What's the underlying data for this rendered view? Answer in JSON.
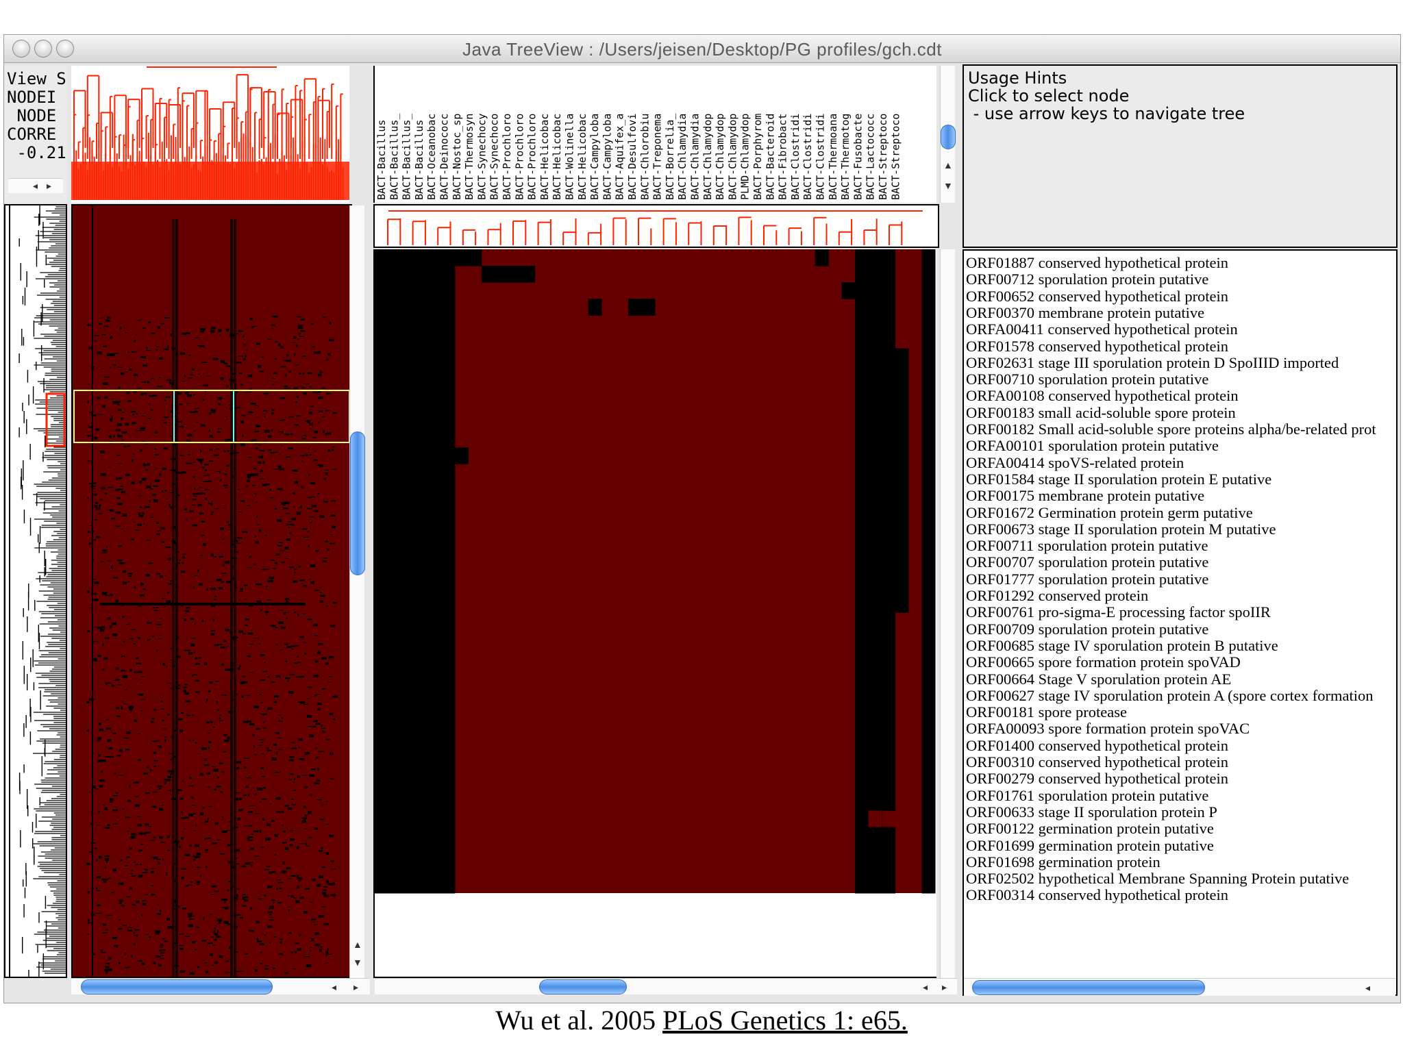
{
  "window": {
    "title": "Java TreeView :  /Users/jeisen/Desktop/PG profiles/gch.cdt"
  },
  "view_stats": {
    "lines": [
      "View St",
      "NODEI",
      " NODE",
      "CORRE",
      " -0.21"
    ]
  },
  "array_names": [
    "BACT-Bacillus",
    "BACT-Bacillus_",
    "BACT-Bacillus_",
    "BACT-Bacillus",
    "BACT-Oceanobac",
    "BACT-Deinococc",
    "BACT-Nostoc_sp",
    "BACT-Thermosyn",
    "BACT-Synechocy",
    "BACT-Synechoco",
    "BACT-Prochloro",
    "BACT-Prochloro",
    "BACT-Prochloro",
    "BACT-Helicobac",
    "BACT-Helicobac",
    "BACT-Wolinella",
    "BACT-Helicobac",
    "BACT-Campyloba",
    "BACT-Campyloba",
    "BACT-Aquifex_a",
    "BACT-Desulfovi",
    "BACT-Chlorobiu",
    "BACT-Treponema",
    "BACT-Borrelia_",
    "BACT-Chlamydia",
    "BACT-Chlamydia",
    "BACT-Chlamydop",
    "BACT-Chlamydop",
    "BACT-Chlamydop",
    "PLMD-Chlamydop",
    "BACT-Porphyrom",
    "BACT-Bacteroid",
    "BACT-Fibrobact",
    "BACT-Clostridi",
    "BACT-Clostridi",
    "BACT-Clostridi",
    "BACT-Thermoana",
    "BACT-Thermotog",
    "BACT-Fusobacte",
    "BACT-Lactococc",
    "BACT-Streptoco",
    "BACT-Streptoco"
  ],
  "usage_hints": {
    "title": "Usage Hints",
    "line1": "Click to select node",
    "line2": " - use arrow keys to navigate tree"
  },
  "genes": [
    "ORF01887 conserved hypothetical protein",
    "ORF00712 sporulation protein putative",
    "ORF00652 conserved hypothetical protein",
    "ORF00370 membrane protein putative",
    "ORFA00411 conserved hypothetical protein",
    "ORF01578 conserved hypothetical protein",
    "ORF02631 stage III sporulation protein D SpoIIID imported",
    "ORF00710 sporulation protein putative",
    "ORFA00108 conserved hypothetical protein",
    "ORF00183 small acid-soluble spore protein",
    "ORF00182 Small acid-soluble spore proteins alpha/be-related prot",
    "ORFA00101 sporulation protein putative",
    "ORFA00414 spoVS-related protein",
    "ORF01584 stage II sporulation protein E putative",
    "ORF00175 membrane protein putative",
    "ORF01672 Germination protein germ putative",
    "ORF00673 stage II sporulation protein M putative",
    "ORF00711 sporulation protein putative",
    "ORF00707 sporulation protein putative",
    "ORF01777 sporulation protein putative",
    "ORF01292 conserved protein",
    "ORF00761 pro-sigma-E processing factor spoIIR",
    "ORF00709 sporulation protein putative",
    "ORF00685 stage IV sporulation protein B putative",
    "ORF00665 spore formation protein spoVAD",
    "ORF00664 Stage V sporulation protein AE",
    "ORF00627 stage IV sporulation protein A (spore cortex formation",
    "ORF00181 spore protease",
    "ORFA00093 spore formation protein spoVAC",
    "ORF01400 conserved hypothetical protein",
    "ORF00310 conserved hypothetical protein",
    "ORF00279 conserved hypothetical protein",
    "ORF01761 sporulation protein putative",
    "ORF00633 stage II sporulation protein P",
    "ORF00122 germination protein putative",
    "ORF01699 germination protein putative",
    "ORF01698 germination protein",
    "ORF02502 hypothetical Membrane Spanning Protein putative",
    "ORF00314 conserved hypothetical protein"
  ],
  "caption": {
    "prefix": "Wu et al. 2005 ",
    "link": "PLoS Genetics 1: e65."
  },
  "colors": {
    "heatmap_background": "#650000",
    "absent": "#000000",
    "tree": "#ff2200",
    "selection_box": "#ffff66",
    "selection_columns": "#66ffff"
  },
  "icons": {
    "left_arrow": "◂",
    "right_arrow": "▸",
    "up_arrow": "▲",
    "down_arrow": "▼"
  }
}
